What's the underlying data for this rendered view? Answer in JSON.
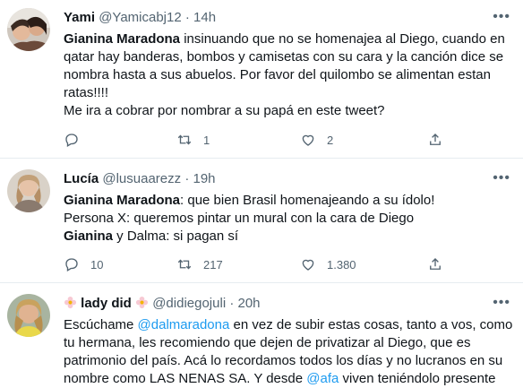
{
  "tweets": [
    {
      "name": "Yami",
      "handle": "@Yamicabj12",
      "sep": "·",
      "time": "14h",
      "lines": {
        "l1": {
          "a": "Gianina Maradona",
          "b": " insinuando que no se homenajea al Diego, cuando en"
        },
        "l2": "qatar hay banderas, bombos y camisetas con su cara y la canción dice se",
        "l3": "nombra hasta a sus abuelos. Por favor del quilombo se alimentan estan",
        "l4": "ratas!!!!",
        "l5": "Me ira a cobrar por nombrar a su papá en este tweet?"
      },
      "stats": {
        "replies": "",
        "retweets": "1",
        "likes": "2"
      }
    },
    {
      "name": "Lucía",
      "handle": "@lusuaarezz",
      "sep": "·",
      "time": "19h",
      "lines": {
        "l1": {
          "a": "Gianina Maradona",
          "b": ": que bien Brasil homenajeando a su ídolo!"
        },
        "l2": "Persona X: queremos pintar un mural con la cara de Diego",
        "l3": {
          "a": "Gianina",
          "b": " y Dalma: si pagan sí"
        }
      },
      "stats": {
        "replies": "10",
        "retweets": "217",
        "likes": "1.380"
      }
    },
    {
      "name": "lady did",
      "handle": "@didiegojuli",
      "sep": "·",
      "time": "20h",
      "lines": {
        "l1": {
          "a": "Escúchame ",
          "m": "@dalmaradona",
          "b": " en vez de subir estas cosas, tanto a vos, como"
        },
        "l2": "tu hermana, les recomiendo que dejen de privatizar al Diego, que es",
        "l3": "patrimonio del país. Acá lo recordamos todos los días y no lucranos en su",
        "l4": {
          "a": "nombre como LAS NENAS SA. Y desde ",
          "m": "@afa",
          "b": " viven teniéndolo presente"
        }
      }
    }
  ],
  "icons": [
    "more-icon",
    "reply-icon",
    "retweet-icon",
    "like-icon",
    "share-icon",
    "flower-emoji-icon"
  ],
  "colors": {
    "link": "#1d9bf0",
    "secondary": "#536471",
    "divider": "#e6ecf0"
  }
}
